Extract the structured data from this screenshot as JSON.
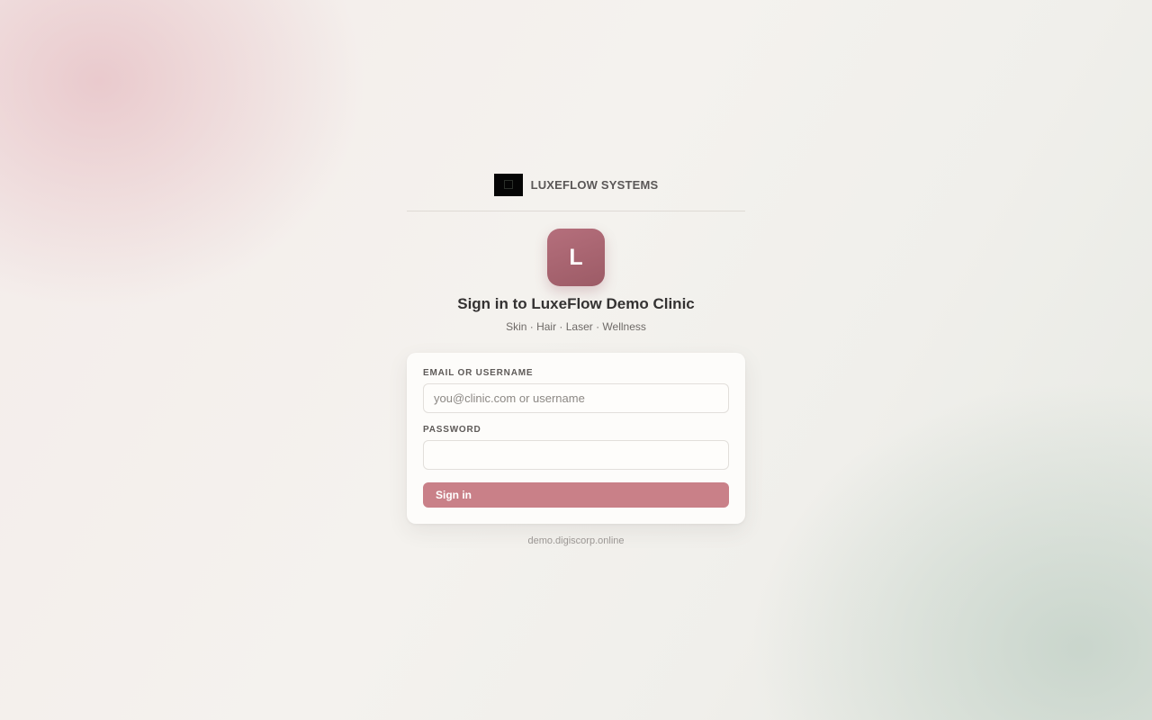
{
  "brand": {
    "name": "LUXEFLOW SYSTEMS",
    "logo_icon": "company-logo"
  },
  "clinic": {
    "badge_letter": "L",
    "badge_color": "#a8636f",
    "title": "Sign in to LuxeFlow Demo Clinic",
    "subtitle": "Skin · Hair · Laser · Wellness"
  },
  "form": {
    "email_label": "EMAIL OR USERNAME",
    "email_placeholder": "you@clinic.com or username",
    "email_value": "",
    "password_label": "PASSWORD",
    "password_value": "",
    "submit_label": "Sign in",
    "submit_color": "#c98088"
  },
  "footer": {
    "domain": "demo.digiscorp.online"
  }
}
